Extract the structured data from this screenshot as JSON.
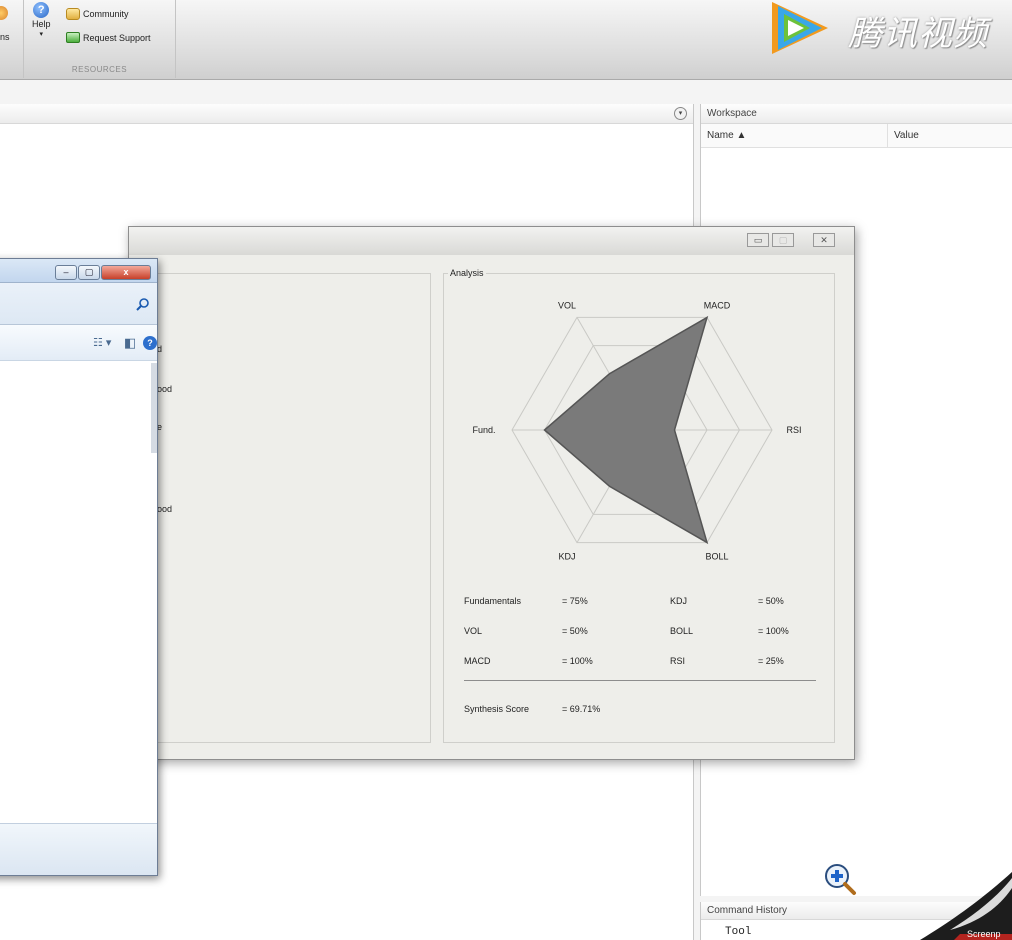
{
  "ribbon": {
    "left_clip_label": "ns",
    "help_label": "Help",
    "community_label": "Community",
    "request_support_label": "Request Support",
    "resources_label": "RESOURCES",
    "brand_text": "腾讯视频"
  },
  "workspace": {
    "title": "Workspace",
    "col_name": "Name ▲",
    "col_value": "Value"
  },
  "command_history": {
    "title": "Command History",
    "items": [
      "Tool"
    ]
  },
  "overlay": {
    "screen_label": "Screenp"
  },
  "explorer": {
    "minimize": "–",
    "maximize": "▢",
    "close": "x",
    "search_icon": "search-icon",
    "view_icon": "☷ ▾",
    "pane_icon": "◧",
    "help_icon": "?"
  },
  "dialog": {
    "minimize": "▭",
    "maximize": "▢",
    "close": "✕",
    "left_clips": [
      "d",
      "ood",
      "e",
      "ood"
    ]
  },
  "analysis": {
    "title": "Analysis",
    "rows": [
      {
        "label": "Fundamentals",
        "value": "= 75%",
        "label2": "KDJ",
        "value2": "= 50%"
      },
      {
        "label": "VOL",
        "value": "= 50%",
        "label2": "BOLL",
        "value2": "= 100%"
      },
      {
        "label": "MACD",
        "value": "= 100%",
        "label2": "RSI",
        "value2": "= 25%"
      }
    ],
    "score_label": "Synthesis Score",
    "score_value": "= 69.71%"
  },
  "colors": {
    "radar_fill": "#7a7a7a",
    "grid": "#c9c9c5",
    "accent_blue": "#2d6fcd"
  },
  "chart_data": {
    "type": "radar",
    "title": "Analysis",
    "axes": [
      "MACD",
      "RSI",
      "BOLL",
      "KDJ",
      "Fund.",
      "VOL"
    ],
    "values": [
      100,
      25,
      100,
      50,
      75,
      50
    ],
    "range": [
      0,
      100
    ],
    "grid_levels": 4
  }
}
